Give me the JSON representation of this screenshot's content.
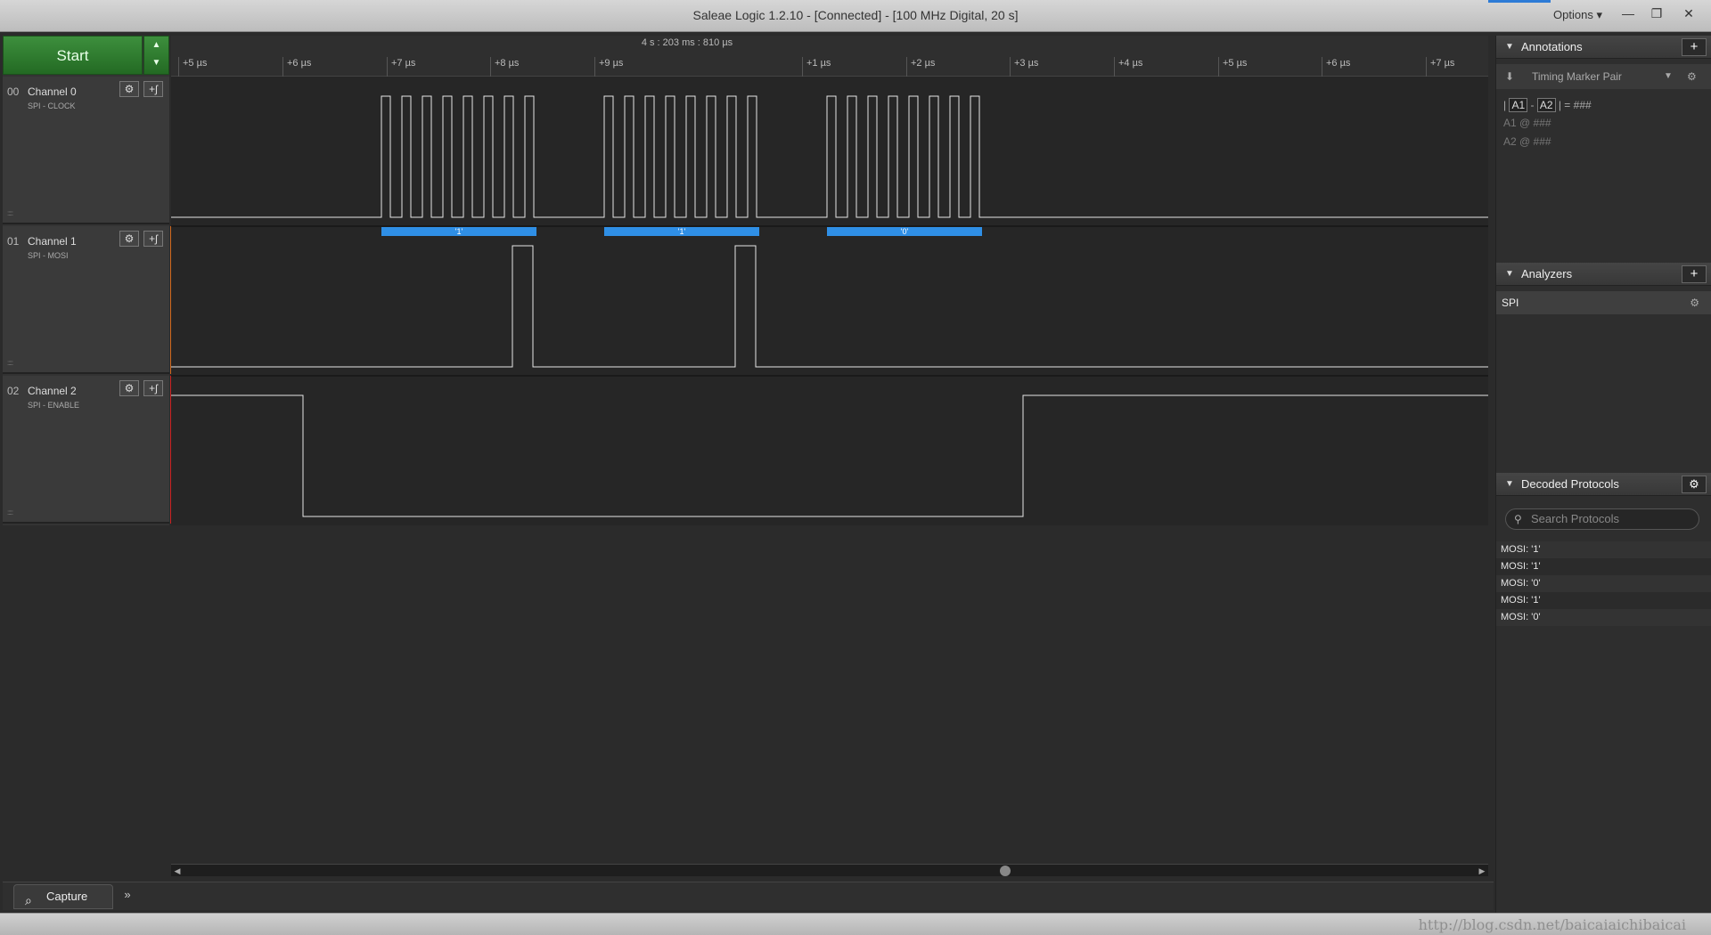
{
  "window": {
    "title": "Saleae Logic 1.2.10 - [Connected] - [100 MHz Digital, 20 s]",
    "options_label": "Options ▾",
    "minimize": "—",
    "restore": "❐",
    "close": "✕"
  },
  "toolbar": {
    "start_label": "Start",
    "arrows": "▲\n▼"
  },
  "channels": [
    {
      "num": "00",
      "name": "Channel 0",
      "sub": "SPI - CLOCK",
      "color": "#3a3a3a"
    },
    {
      "num": "01",
      "name": "Channel 1",
      "sub": "SPI - MOSI",
      "color": "#d2691e"
    },
    {
      "num": "02",
      "name": "Channel 2",
      "sub": "SPI - ENABLE",
      "color": "#cc2222"
    }
  ],
  "timeline": {
    "center_label": "4 s : 203 ms : 810 µs",
    "ticks": [
      "+5 µs",
      "+6 µs",
      "+7 µs",
      "+8 µs",
      "+9 µs",
      "+1 µs",
      "+2 µs",
      "+3 µs",
      "+4 µs",
      "+5 µs",
      "+6 µs",
      "+7 µs"
    ],
    "decodes": [
      "'1'",
      "'1'",
      "'0'"
    ]
  },
  "bottom": {
    "capture_label": "Capture",
    "more_label": "»"
  },
  "annotations": {
    "title": "Annotations",
    "marker_label": "Timing Marker Pair",
    "a1": "A1",
    "a2": "A2",
    "diff_value": "###",
    "a1_row": "A1  @  ###",
    "a2_row": "A2  @  ###"
  },
  "analyzers": {
    "title": "Analyzers",
    "items": [
      "SPI"
    ]
  },
  "decoded": {
    "title": "Decoded Protocols",
    "search_placeholder": "Search Protocols",
    "items": [
      "MOSI: '1'",
      "MOSI: '1'",
      "MOSI: '0'",
      "MOSI: '1'",
      "MOSI: '0'"
    ]
  },
  "watermark": "http://blog.csdn.net/baicaiaichibaicai"
}
